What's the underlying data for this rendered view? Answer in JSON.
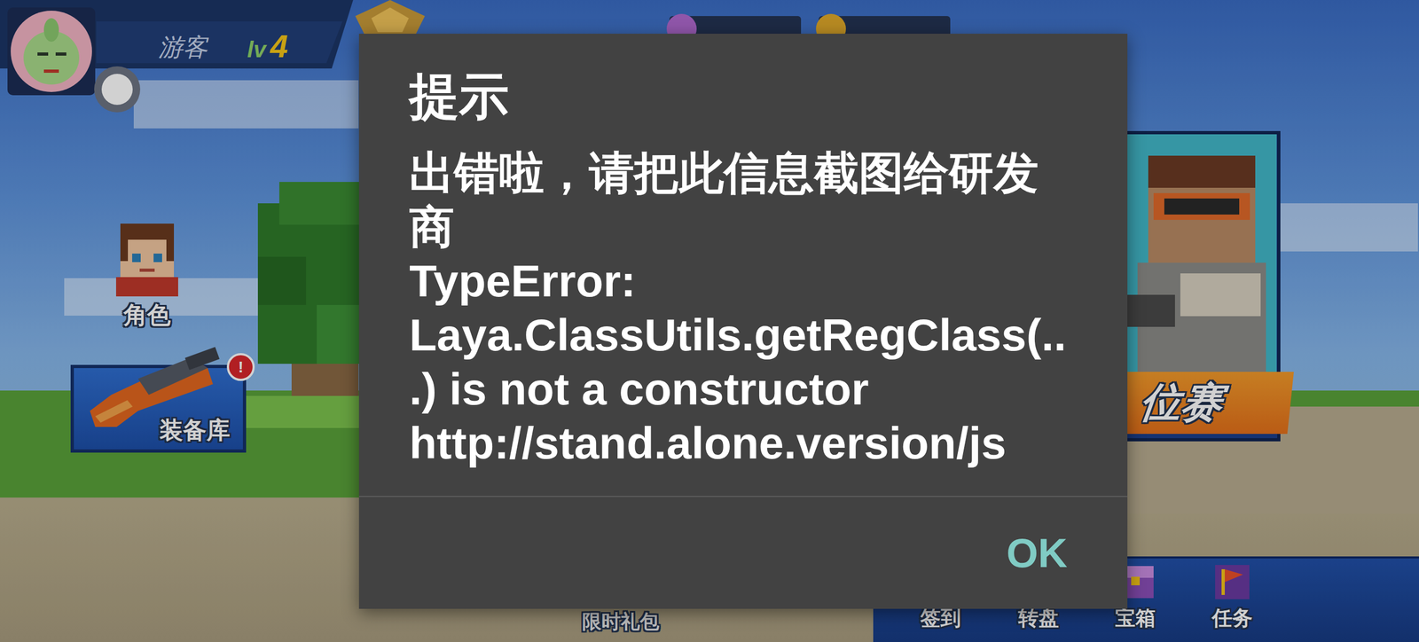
{
  "player": {
    "name": "游客",
    "level_prefix": "lv",
    "level": "4"
  },
  "side_buttons": [
    {
      "label": "角色"
    },
    {
      "label": "装备库",
      "badge": "!"
    }
  ],
  "event_banner": {
    "label": "位赛"
  },
  "promo": {
    "label": "限时礼包"
  },
  "bottom_menu": [
    {
      "label": "签到"
    },
    {
      "label": "转盘"
    },
    {
      "label": "宝箱"
    },
    {
      "label": "任务"
    }
  ],
  "dialog": {
    "title": "提示",
    "message": [
      "出错啦，请把此信息截图给研发商",
      "TypeError: Laya.ClassUtils.getRegClass(...) is not a constructor http://stand.alone.version/js"
    ],
    "buttons": [
      "OK"
    ]
  }
}
